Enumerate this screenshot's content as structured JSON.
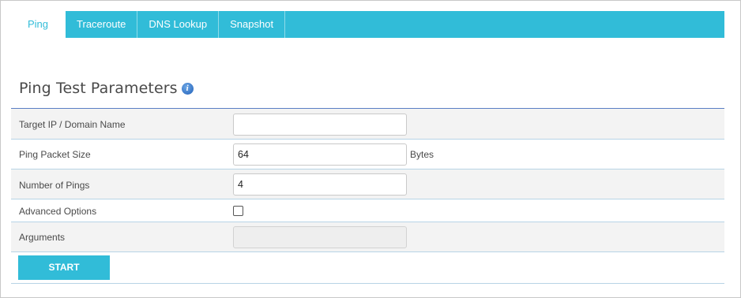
{
  "tabs": [
    {
      "label": "Ping"
    },
    {
      "label": "Traceroute"
    },
    {
      "label": "DNS Lookup"
    },
    {
      "label": "Snapshot"
    }
  ],
  "active_tab": "Ping",
  "section": {
    "title": "Ping Test Parameters",
    "info_icon": "i"
  },
  "form": {
    "target": {
      "label": "Target IP / Domain Name",
      "value": ""
    },
    "packet_size": {
      "label": "Ping Packet Size",
      "value": "64",
      "unit": "Bytes"
    },
    "num_pings": {
      "label": "Number of Pings",
      "value": "4"
    },
    "advanced": {
      "label": "Advanced Options",
      "checked": false
    },
    "arguments": {
      "label": "Arguments",
      "value": "",
      "disabled": true
    }
  },
  "actions": {
    "start_label": "START"
  },
  "colors": {
    "accent": "#31bcd8",
    "divider": "#5a7fc4",
    "row_alt": "#f3f3f3"
  }
}
